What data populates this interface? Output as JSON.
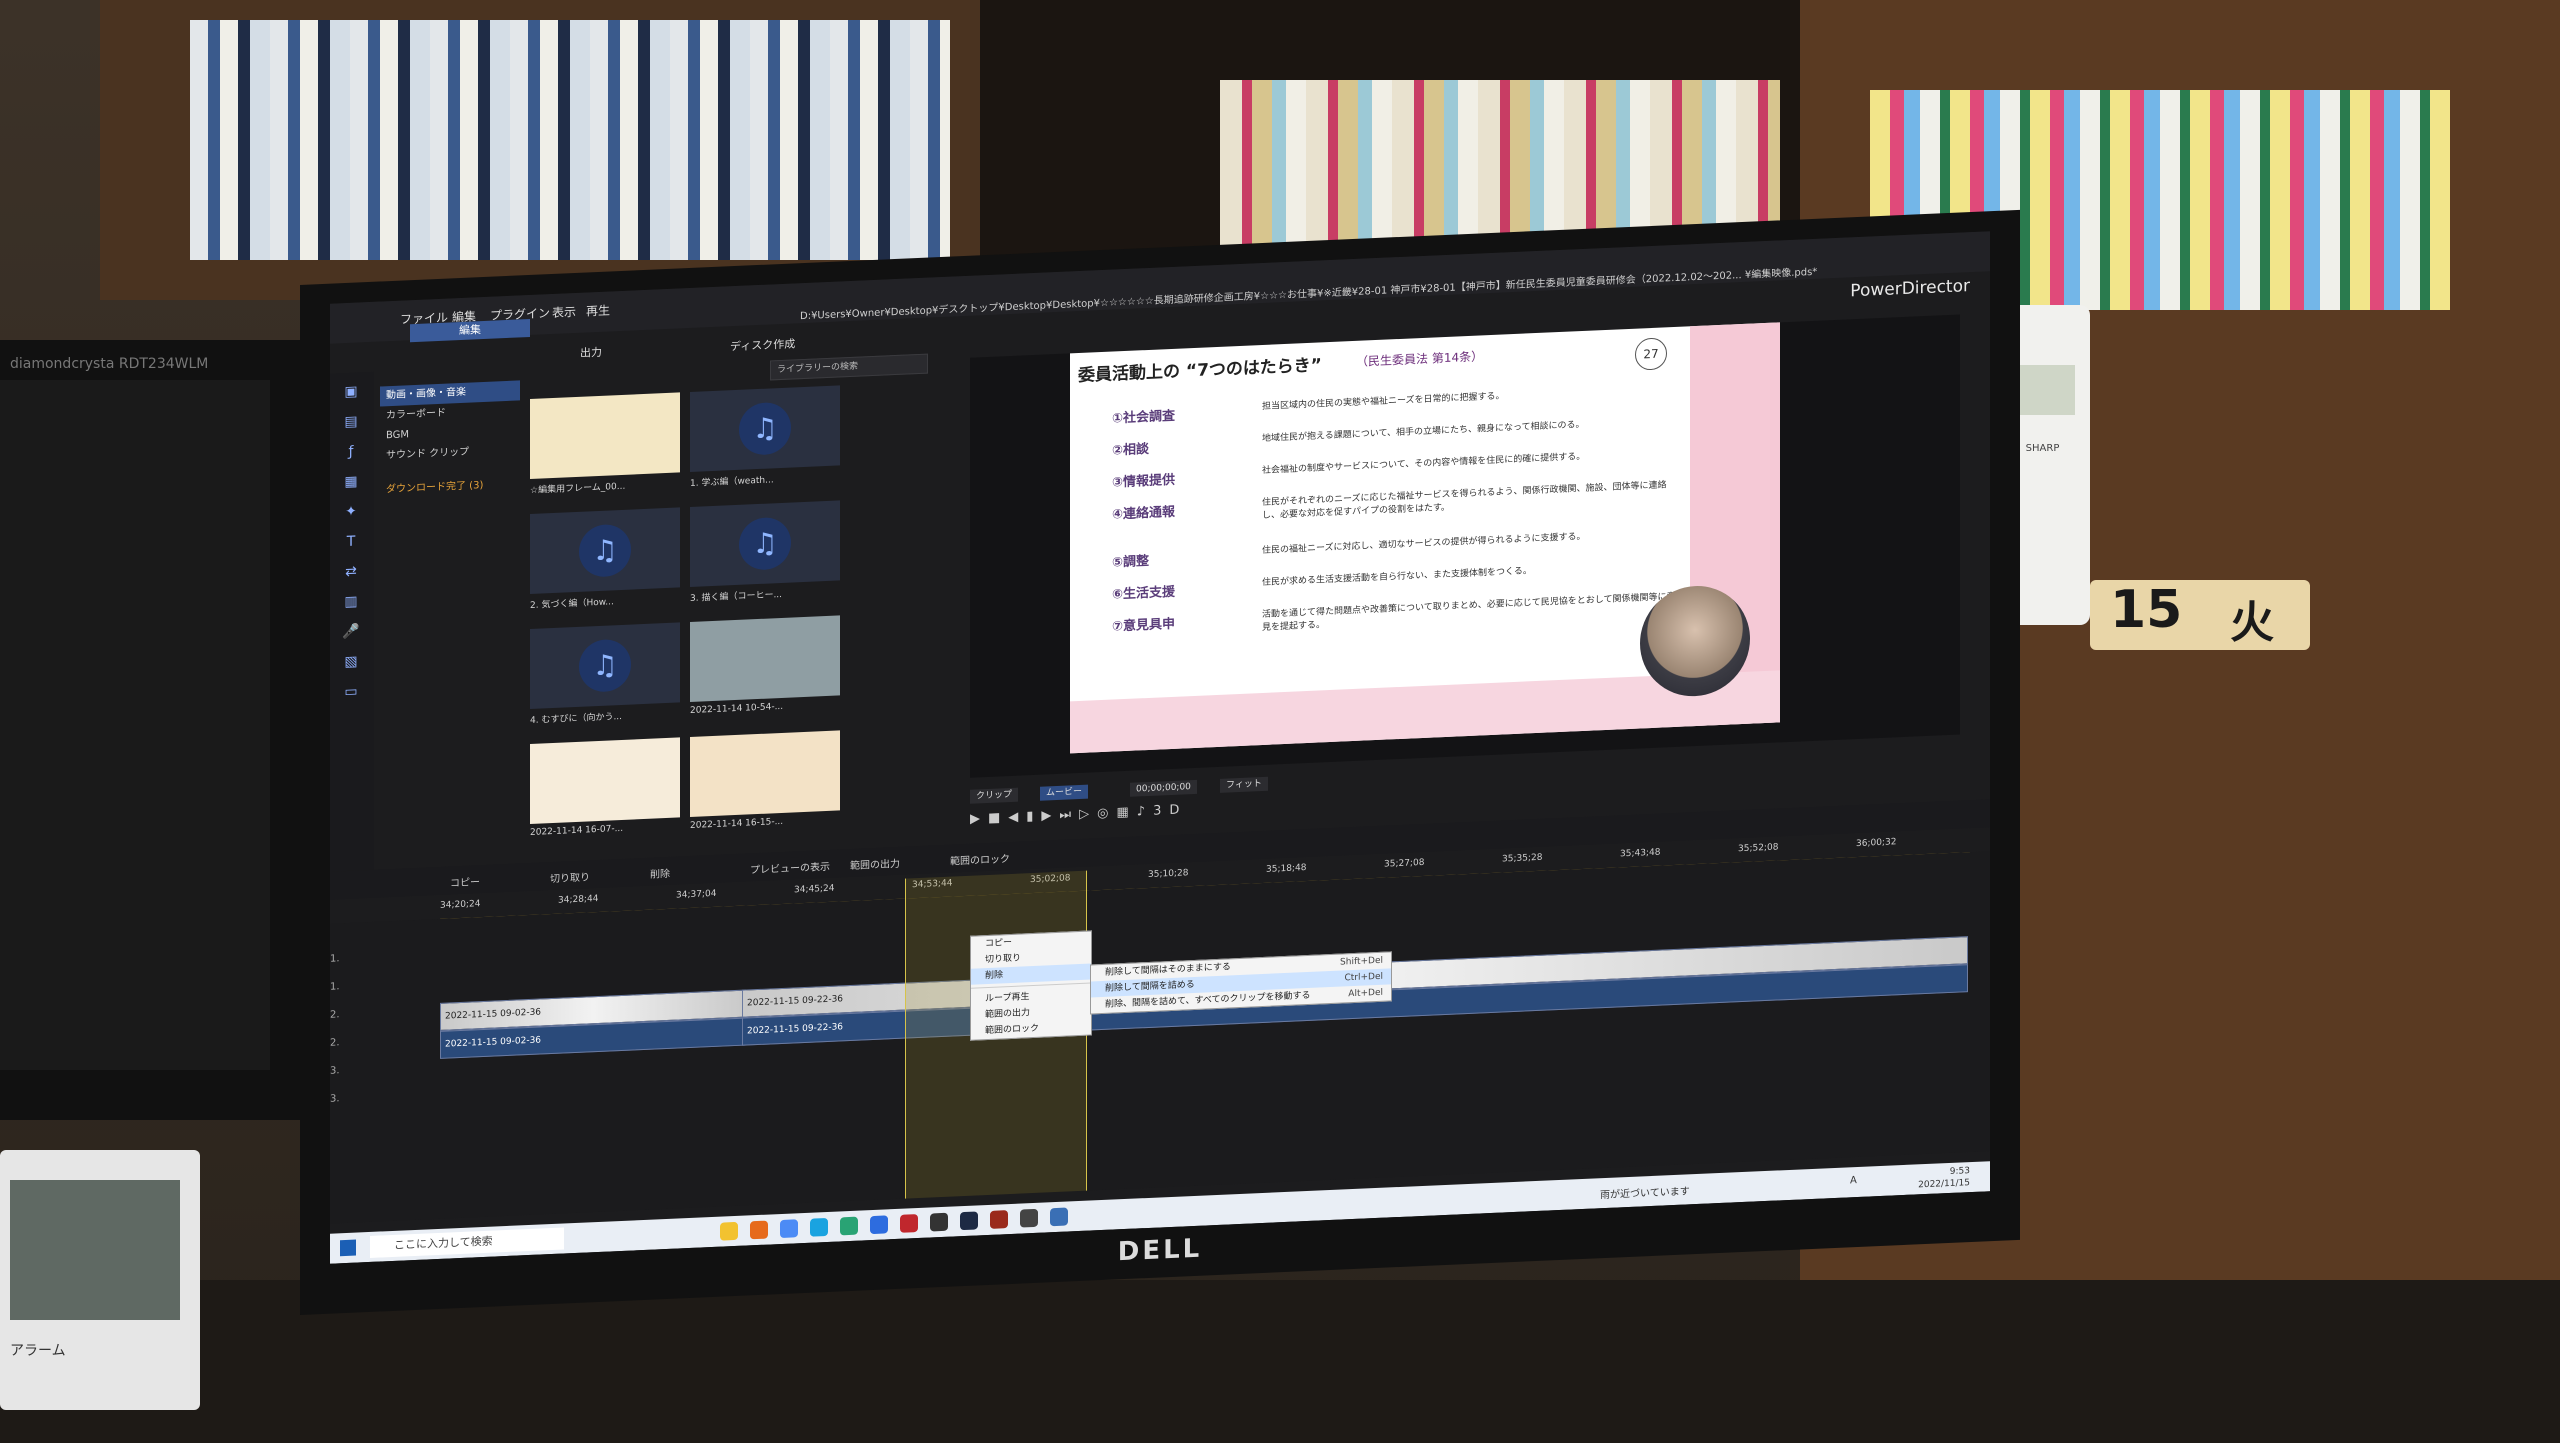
{
  "left_monitor": {
    "brand": "diamondcrysta RDT234WLM"
  },
  "clock_device": {
    "label": "アラーム"
  },
  "monitor_brand": "DELL",
  "app": {
    "name": "PowerDirector",
    "menu": [
      "ファイル",
      "編集",
      "プラグイン",
      "表示",
      "再生"
    ],
    "title_path": "D:¥Users¥Owner¥Desktop¥デスクトップ¥Desktop¥Desktop¥☆☆☆☆☆☆長期追跡研修企画工房¥☆☆☆お仕事¥※近畿¥28-01 神戸市¥28-01【神戸市】新任民生委員児童委員研修会（2022.12.02〜202... ¥編集映像.pds*",
    "tabs": {
      "edit": "編集",
      "output": "出力",
      "disc": "ディスク作成"
    },
    "library": {
      "categories": [
        "動画・画像・音楽",
        "カラーボード",
        "BGM",
        "サウンド クリップ"
      ],
      "download_status": "ダウンロード完了 (3)",
      "search_placeholder": "ライブラリーの検索",
      "items": [
        {
          "caption": "☆編集用フレーム_00...",
          "type": "image"
        },
        {
          "caption": "1. 学ぶ編（weath...",
          "type": "audio"
        },
        {
          "caption": "2. 気づく編（How...",
          "type": "audio"
        },
        {
          "caption": "3. 描く編（コーヒー...",
          "type": "audio"
        },
        {
          "caption": "4. むすびに（向かう...",
          "type": "audio"
        },
        {
          "caption": "2022-11-14 10-54-...",
          "type": "video"
        },
        {
          "caption": "2022-11-14 16-07-...",
          "type": "image"
        },
        {
          "caption": "2022-11-14 16-15-...",
          "type": "image"
        }
      ]
    },
    "preview": {
      "slide": {
        "title": "委員活動上の “7つのはたらき”",
        "subtitle": "（民生委員法 第14条）",
        "page": "27",
        "rows": [
          {
            "head": "①社会調査",
            "body": "担当区域内の住民の実態や福祉ニーズを日常的に把握する。"
          },
          {
            "head": "②相談",
            "body": "地域住民が抱える課題について、相手の立場にたち、親身になって相談にのる。"
          },
          {
            "head": "③情報提供",
            "body": "社会福祉の制度やサービスについて、その内容や情報を住民に的確に提供する。"
          },
          {
            "head": "④連絡通報",
            "body": "住民がそれぞれのニーズに応じた福祉サービスを得られるよう、関係行政機関、施設、団体等に連絡し、必要な対応を促すパイプの役割をはたす。"
          },
          {
            "head": "⑤調整",
            "body": "住民の福祉ニーズに対応し、適切なサービスの提供が得られるように支援する。"
          },
          {
            "head": "⑥生活支援",
            "body": "住民が求める生活支援活動を自ら行ない、また支援体制をつくる。"
          },
          {
            "head": "⑦意見具申",
            "body": "活動を通じて得た問題点や改善策について取りまとめ、必要に応じて民児協をとおして関係機関等に意見を提起する。"
          }
        ]
      },
      "clip_label": "クリップ",
      "movie_label": "ムービー",
      "timecode": "00;00;00;00",
      "fit_label": "フィット",
      "mode_3d": "3D"
    },
    "timeline_toolbar": [
      "コピー",
      "切り取り",
      "削除",
      "プレビューの表示",
      "範囲の出力",
      "範囲のロック"
    ],
    "ruler_ticks": [
      "34;20;24",
      "34;28;44",
      "34;37;04",
      "34;45;24",
      "34;53;44",
      "35;02;08",
      "35;10;28",
      "35;18;48",
      "35;27;08",
      "35;35;28",
      "35;43;48",
      "35;52;08",
      "36;00;32"
    ],
    "tracks": [
      "1.",
      "1.",
      "2.",
      "2.",
      "3.",
      "3."
    ],
    "clips": {
      "video_a": "2022-11-15 09-02-36",
      "video_b": "2022-11-15 09-22-36",
      "audio_a": "2022-11-15 09-02-36",
      "audio_b": "2022-11-15 09-22-36"
    },
    "context_menu": {
      "items": [
        "コピー",
        "切り取り",
        "削除",
        "ループ再生",
        "範囲の出力",
        "範囲のロック"
      ],
      "submenu": [
        {
          "label": "削除して間隔はそのままにする",
          "shortcut": "Shift+Del"
        },
        {
          "label": "削除して間隔を詰める",
          "shortcut": "Ctrl+Del"
        },
        {
          "label": "削除、間隔を詰めて、すべてのクリップを移動する",
          "shortcut": "Alt+Del"
        }
      ]
    }
  },
  "taskbar": {
    "search_placeholder": "ここに入力して検索",
    "weather": "雨が近づいています",
    "time": "9:53",
    "date": "2022/11/15",
    "ime": "A"
  },
  "room": {
    "phone_brand": "SHARP",
    "calendar_date": "15",
    "calendar_day": "火"
  }
}
